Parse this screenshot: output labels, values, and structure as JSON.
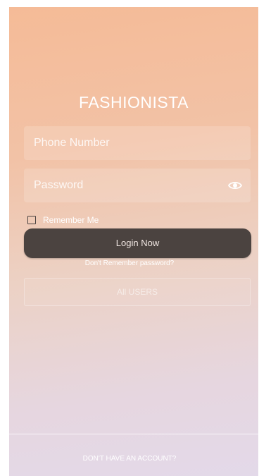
{
  "app": {
    "title": "FASHIONISTA"
  },
  "form": {
    "phone_placeholder": "Phone Number",
    "password_placeholder": "Password",
    "password_toggle_icon": "eye-icon",
    "remember_label": "Remember Me",
    "remember_checked": false
  },
  "actions": {
    "login_label": "Login Now",
    "forgot_label": "Don't Remember password?",
    "all_users_label": "All USERS"
  },
  "footer": {
    "signup_label": "DON'T HAVE AN ACCOUNT?"
  },
  "colors": {
    "gradient_top": "#f5bb97",
    "gradient_bottom": "#e3d9e9",
    "button_dark": "#4b4340"
  }
}
